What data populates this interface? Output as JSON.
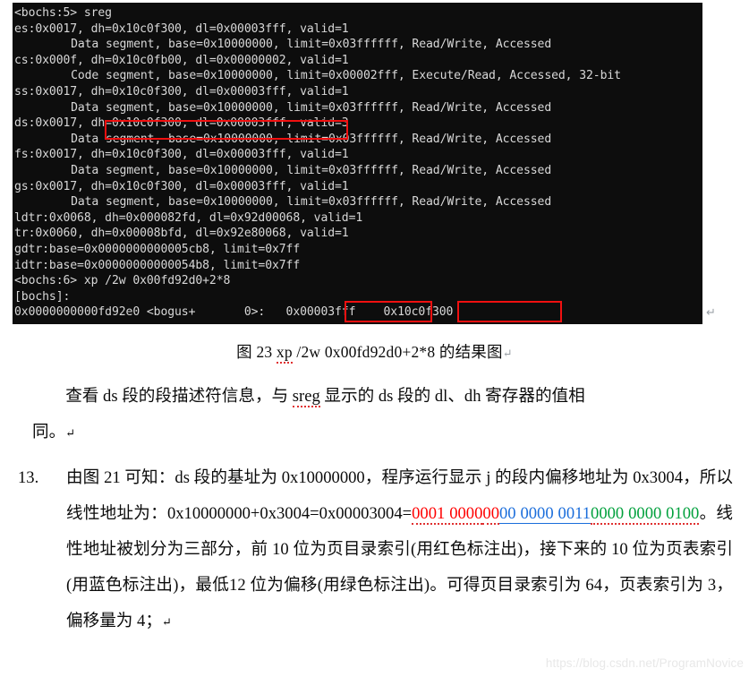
{
  "terminal": {
    "lines": [
      {
        "indent": false,
        "text": "<bochs:5> sreg"
      },
      {
        "indent": false,
        "text": "es:0x0017, dh=0x10c0f300, dl=0x00003fff, valid=1"
      },
      {
        "indent": true,
        "text": "Data segment, base=0x10000000, limit=0x03ffffff, Read/Write, Accessed"
      },
      {
        "indent": false,
        "text": "cs:0x000f, dh=0x10c0fb00, dl=0x00000002, valid=1"
      },
      {
        "indent": true,
        "text": "Code segment, base=0x10000000, limit=0x00002fff, Execute/Read, Accessed, 32-bit"
      },
      {
        "indent": false,
        "text": "ss:0x0017, dh=0x10c0f300, dl=0x00003fff, valid=1"
      },
      {
        "indent": true,
        "text": "Data segment, base=0x10000000, limit=0x03ffffff, Read/Write, Accessed"
      },
      {
        "indent": false,
        "text": "ds:0x0017, dh=0x10c0f300, dl=0x00003fff, valid=3"
      },
      {
        "indent": true,
        "text": "Data segment, base=0x10000000, limit=0x03ffffff, Read/Write, Accessed"
      },
      {
        "indent": false,
        "text": "fs:0x0017, dh=0x10c0f300, dl=0x00003fff, valid=1"
      },
      {
        "indent": true,
        "text": "Data segment, base=0x10000000, limit=0x03ffffff, Read/Write, Accessed"
      },
      {
        "indent": false,
        "text": "gs:0x0017, dh=0x10c0f300, dl=0x00003fff, valid=1"
      },
      {
        "indent": true,
        "text": "Data segment, base=0x10000000, limit=0x03ffffff, Read/Write, Accessed"
      },
      {
        "indent": false,
        "text": "ldtr:0x0068, dh=0x000082fd, dl=0x92d00068, valid=1"
      },
      {
        "indent": false,
        "text": "tr:0x0060, dh=0x00008bfd, dl=0x92e80068, valid=1"
      },
      {
        "indent": false,
        "text": "gdtr:base=0x0000000000005cb8, limit=0x7ff"
      },
      {
        "indent": false,
        "text": "idtr:base=0x00000000000054b8, limit=0x7ff"
      },
      {
        "indent": false,
        "text": "<bochs:6> xp /2w 0x00fd92d0+2*8"
      },
      {
        "indent": false,
        "text": "[bochs]:"
      },
      {
        "indent": false,
        "text": "0x0000000000fd92e0 <bogus+       0>:   0x00003fff    0x10c0f300"
      }
    ],
    "highlight_boxes": [
      {
        "name": "ds-dh-dl-box",
        "value": "dh=0x10c0f300, dl=0x00003fff,"
      },
      {
        "name": "xp-dl-value-box",
        "value": "0x00003fff"
      },
      {
        "name": "xp-dh-value-box",
        "value": "0x10c0f300"
      }
    ],
    "paragraph_mark": "↵"
  },
  "caption": {
    "prefix": "图 23 ",
    "command_spelled": "xp",
    "command_rest": " /2w 0x00fd92d0+2*8 ",
    "suffix": "的结果图",
    "pilcrow": "↵"
  },
  "paragraph1": {
    "part_a": "查看 ds 段的段描述符信息，与 ",
    "misspelled": "sreg",
    "part_b": " 显示的 ds 段的 dl、dh 寄存器的值相",
    "part_c": "同。",
    "pilcrow": "↵"
  },
  "list_item_13": {
    "number": "13.",
    "line1": "由图 21 可知：ds 段的基址为 0x10000000，程序运行显示 j 的段内偏移地址",
    "line2_pre": "为 0x3004，所以线性地址为：0x10000000+0x3004=0x00003004=",
    "binary_red_1": "0001 0000",
    "binary_red_2": "00",
    "binary_blue": "00 0000 0011",
    "binary_green": "0000 0000 0100",
    "line3_post": "。线性地址被划分为三部分，前 10 位为页目",
    "line4": "录索引(用红色标注出)，接下来的 10 位为页表索引(用蓝色标注出)，最低",
    "line5": "12 位为偏移(用绿色标注出)。可得页目录索引为 64，页表索引为 3，偏移",
    "line6": "量为 4；",
    "pilcrow": "↵"
  },
  "watermark": {
    "text": "https://blog.csdn.net/ProgramNovice"
  },
  "colors": {
    "terminal_bg": "#0d0d0d",
    "terminal_fg": "#d8d8d8",
    "annotation_red": "#f01010",
    "bin_red": "#ff0000",
    "bin_blue": "#1a6ddb",
    "bin_green": "#00a03c"
  }
}
